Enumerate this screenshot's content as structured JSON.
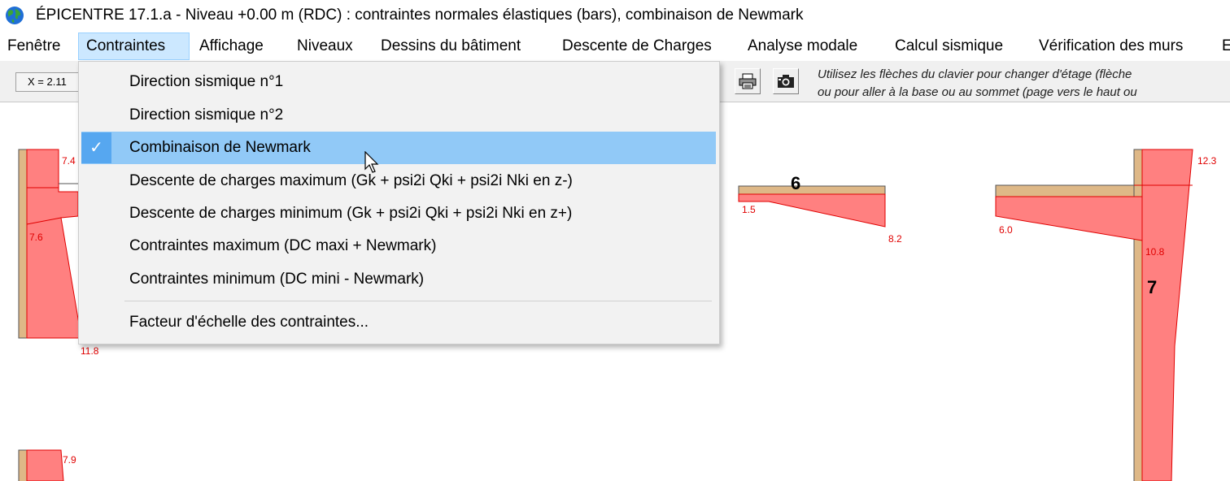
{
  "window": {
    "title": "ÉPICENTRE 17.1.a - Niveau +0.00 m (RDC) : contraintes normales élastiques (bars), combinaison de Newmark",
    "icon": "globe-icon"
  },
  "menubar": {
    "items": [
      {
        "label": "Fenêtre"
      },
      {
        "label": "Contraintes"
      },
      {
        "label": "Affichage"
      },
      {
        "label": "Niveaux"
      },
      {
        "label": "Dessins du bâtiment"
      },
      {
        "label": "Descente de Charges"
      },
      {
        "label": "Analyse modale"
      },
      {
        "label": "Calcul sismique"
      },
      {
        "label": "Vérification des murs"
      },
      {
        "label": "E"
      }
    ],
    "active_index": 1
  },
  "toolbar": {
    "coord_label": "X = 2.11",
    "buttons": [
      {
        "icon": "printer-icon"
      },
      {
        "icon": "camera-icon"
      }
    ],
    "hint_line1": "Utilisez les flèches du clavier pour changer d'étage (flèche",
    "hint_line2": "ou pour aller à la base ou au sommet (page vers le haut ou"
  },
  "dropdown": {
    "items": [
      {
        "label": "Direction sismique n°1",
        "checked": false
      },
      {
        "label": "Direction sismique n°2",
        "checked": false
      },
      {
        "label": "Combinaison de Newmark",
        "checked": true
      },
      {
        "label": "Descente de charges maximum (Gk + psi2i Qki + psi2i Nki en z-)",
        "checked": false
      },
      {
        "label": "Descente de charges minimum (Gk + psi2i Qki + psi2i Nki en z+)",
        "checked": false
      },
      {
        "label": "Contraintes maximum (DC maxi + Newmark)",
        "checked": false
      },
      {
        "label": "Contraintes minimum (DC mini - Newmark)",
        "checked": false
      }
    ],
    "footer_item": {
      "label": "Facteur d'échelle des contraintes..."
    },
    "check_glyph": "✓"
  },
  "canvas": {
    "colors": {
      "wall": "#deb887",
      "stress_fill": "#ff8080",
      "stress_stroke": "#e00000",
      "label": "#e00000"
    },
    "labels": {
      "left_top": "7.4",
      "left_mid": "7.6",
      "left_bottom": "11.8",
      "left_lower": "7.9",
      "wall6_left": "1.5",
      "wall6_right": "8.2",
      "right_top": "12.3",
      "right_left": "6.0",
      "right_mid": "10.8"
    },
    "wall_numbers": {
      "wall6": "6",
      "wall7": "7"
    }
  }
}
